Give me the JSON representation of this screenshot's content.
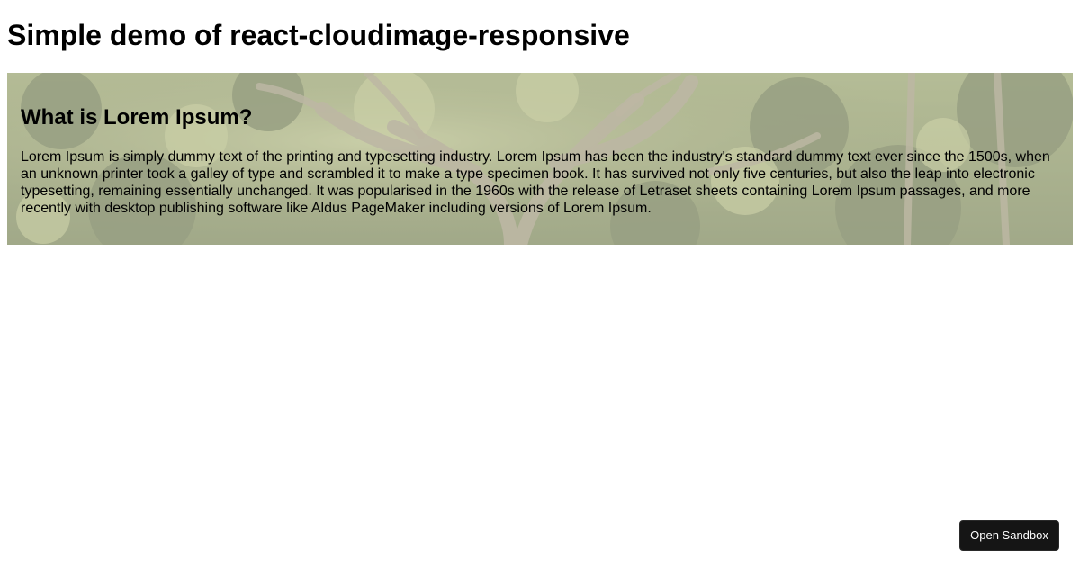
{
  "page": {
    "title": "Simple demo of react-cloudimage-responsive"
  },
  "hero": {
    "heading": "What is Lorem Ipsum?",
    "body": "Lorem Ipsum is simply dummy text of the printing and typesetting industry. Lorem Ipsum has been the industry's standard dummy text ever since the 1500s, when an unknown printer took a galley of type and scrambled it to make a type specimen book. It has survived not only five centuries, but also the leap into electronic typesetting, remaining essentially unchanged. It was popularised in the 1960s with the release of Letraset sheets containing Lorem Ipsum passages, and more recently with desktop publishing software like Aldus PageMaker including versions of Lorem Ipsum.",
    "background_icon": "forest-photo"
  },
  "actions": {
    "open_sandbox_label": "Open Sandbox"
  },
  "colors": {
    "button_bg": "#151515",
    "button_text": "#ffffff",
    "foliage_dark": "#4d5a2c",
    "foliage_light": "#9aa45f",
    "bark": "#8b8160"
  }
}
